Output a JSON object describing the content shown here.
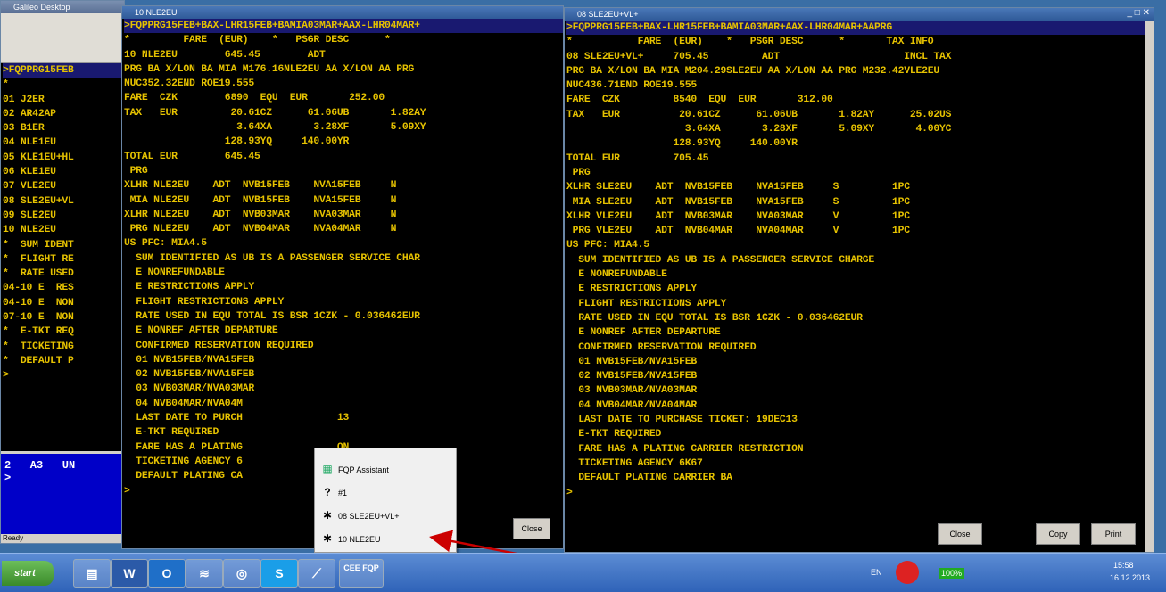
{
  "bg_window": {
    "title": "Galileo Desktop",
    "lines": [
      ">FQPPRG15FEB",
      "",
      "*",
      "01 J2ER",
      "02 AR42AP",
      "03 B1ER",
      "04 NLE1EU",
      "05 KLE1EU+HL",
      "06 KLE1EU",
      "07 VLE2EU",
      "08 SLE2EU+VL",
      "09 SLE2EU",
      "10 NLE2EU",
      "*  SUM IDENT",
      "*  FLIGHT RE",
      "*  RATE USED",
      "04-10 E  RES",
      "04-10 E  NON",
      "07-10 E  NON",
      "*  E-TKT REQ",
      "*  TICKETING",
      "*  DEFAULT P",
      ">"
    ],
    "blue_panel": "2   A3   UN\n>",
    "status": "Ready"
  },
  "win1": {
    "title": "10 NLE2EU",
    "lines": [
      ">FQPPRG15FEB+BAX-LHR15FEB+BAMIA03MAR+AAX-LHR04MAR+",
      "*         FARE  (EUR)    *   PSGR DESC      *",
      "10 NLE2EU        645.45        ADT",
      "",
      "PRG BA X/LON BA MIA M176.16NLE2EU AA X/LON AA PRG",
      "NUC352.32END ROE19.555",
      "FARE  CZK        6890  EQU  EUR       252.00",
      "TAX   EUR         20.61CZ      61.06UB       1.82AY",
      "                   3.64XA       3.28XF       5.09XY",
      "                 128.93YQ     140.00YR",
      "TOTAL EUR        645.45",
      "",
      " PRG",
      "XLHR NLE2EU    ADT  NVB15FEB    NVA15FEB     N",
      " MIA NLE2EU    ADT  NVB15FEB    NVA15FEB     N",
      "XLHR NLE2EU    ADT  NVB03MAR    NVA03MAR     N",
      " PRG NLE2EU    ADT  NVB04MAR    NVA04MAR     N",
      "US PFC: MIA4.5",
      "  SUM IDENTIFIED AS UB IS A PASSENGER SERVICE CHAR",
      "  E NONREFUNDABLE",
      "  E RESTRICTIONS APPLY",
      "  FLIGHT RESTRICTIONS APPLY",
      "  RATE USED IN EQU TOTAL IS BSR 1CZK - 0.036462EUR",
      "  E NONREF AFTER DEPARTURE",
      "  CONFIRMED RESERVATION REQUIRED",
      "  01 NVB15FEB/NVA15FEB",
      "  02 NVB15FEB/NVA15FEB",
      "  03 NVB03MAR/NVA03MAR",
      "  04 NVB04MAR/NVA04M",
      "  LAST DATE TO PURCH                13",
      "  E-TKT REQUIRED",
      "  FARE HAS A PLATING                ON",
      "  TICKETING AGENCY 6",
      "  DEFAULT PLATING CA",
      ">"
    ],
    "close": "Close"
  },
  "win2": {
    "title": "08 SLE2EU+VL+",
    "lines": [
      ">FQPPRG15FEB+BAX-LHR15FEB+BAMIA03MAR+AAX-LHR04MAR+AAPRG",
      "*           FARE  (EUR)    *   PSGR DESC      *       TAX INFO",
      "08 SLE2EU+VL+     705.45         ADT                     INCL TAX",
      "",
      "PRG BA X/LON BA MIA M204.29SLE2EU AA X/LON AA PRG M232.42VLE2EU",
      "NUC436.71END ROE19.555",
      "FARE  CZK         8540  EQU  EUR       312.00",
      "TAX   EUR          20.61CZ      61.06UB       1.82AY      25.02US",
      "                    3.64XA       3.28XF       5.09XY       4.00YC",
      "                  128.93YQ     140.00YR",
      "TOTAL EUR         705.45",
      "",
      " PRG",
      "XLHR SLE2EU    ADT  NVB15FEB    NVA15FEB     S         1PC",
      " MIA SLE2EU    ADT  NVB15FEB    NVA15FEB     S         1PC",
      "XLHR VLE2EU    ADT  NVB03MAR    NVA03MAR     V         1PC",
      " PRG VLE2EU    ADT  NVB04MAR    NVA04MAR     V         1PC",
      "US PFC: MIA4.5",
      "  SUM IDENTIFIED AS UB IS A PASSENGER SERVICE CHARGE",
      "  E NONREFUNDABLE",
      "  E RESTRICTIONS APPLY",
      "  FLIGHT RESTRICTIONS APPLY",
      "  RATE USED IN EQU TOTAL IS BSR 1CZK - 0.036462EUR",
      "  E NONREF AFTER DEPARTURE",
      "  CONFIRMED RESERVATION REQUIRED",
      "  01 NVB15FEB/NVA15FEB",
      "  02 NVB15FEB/NVA15FEB",
      "  03 NVB03MAR/NVA03MAR",
      "  04 NVB04MAR/NVA04MAR",
      "  LAST DATE TO PURCHASE TICKET: 19DEC13",
      "  E-TKT REQUIRED",
      "  FARE HAS A PLATING CARRIER RESTRICTION",
      "  TICKETING AGENCY 6K67",
      "  DEFAULT PLATING CARRIER BA",
      ">"
    ],
    "buttons": {
      "close": "Close",
      "copy": "Copy",
      "print": "Print"
    }
  },
  "popup": {
    "items": [
      "FQP Assistant",
      "#1",
      "08 SLE2EU+VL+",
      "10 NLE2EU"
    ]
  },
  "taskbar": {
    "start": "start",
    "cee_fqp": "CEE FQP",
    "lang": "EN",
    "battery": "100%",
    "time": "15:58",
    "date": "16.12.2013"
  },
  "colors": {
    "terminal_text": "#e6c200",
    "terminal_bg": "#000000",
    "arrow": "#cc0000"
  }
}
